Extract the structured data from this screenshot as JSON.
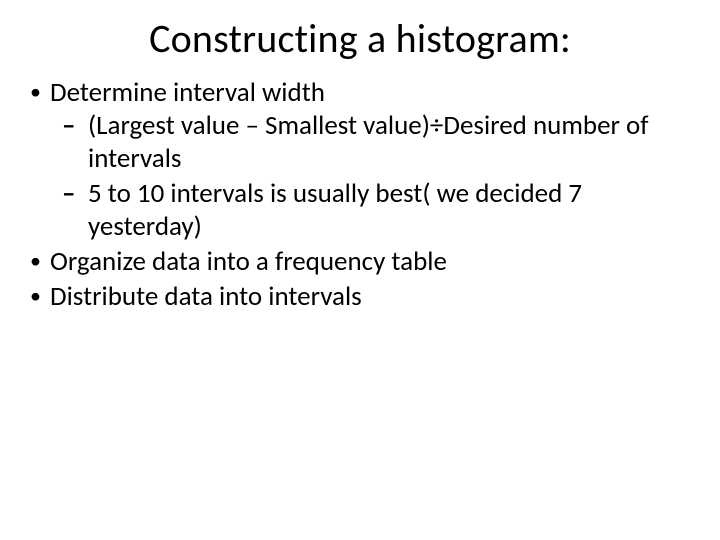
{
  "title": "Constructing a histogram:",
  "bullets": {
    "b1": "Determine interval width",
    "b1a": "(Largest value – Smallest value)÷Desired number of intervals",
    "b1b": "5 to 10 intervals is usually best( we decided 7 yesterday)",
    "b2": "Organize data into a frequency table",
    "b3": "Distribute data into intervals"
  }
}
